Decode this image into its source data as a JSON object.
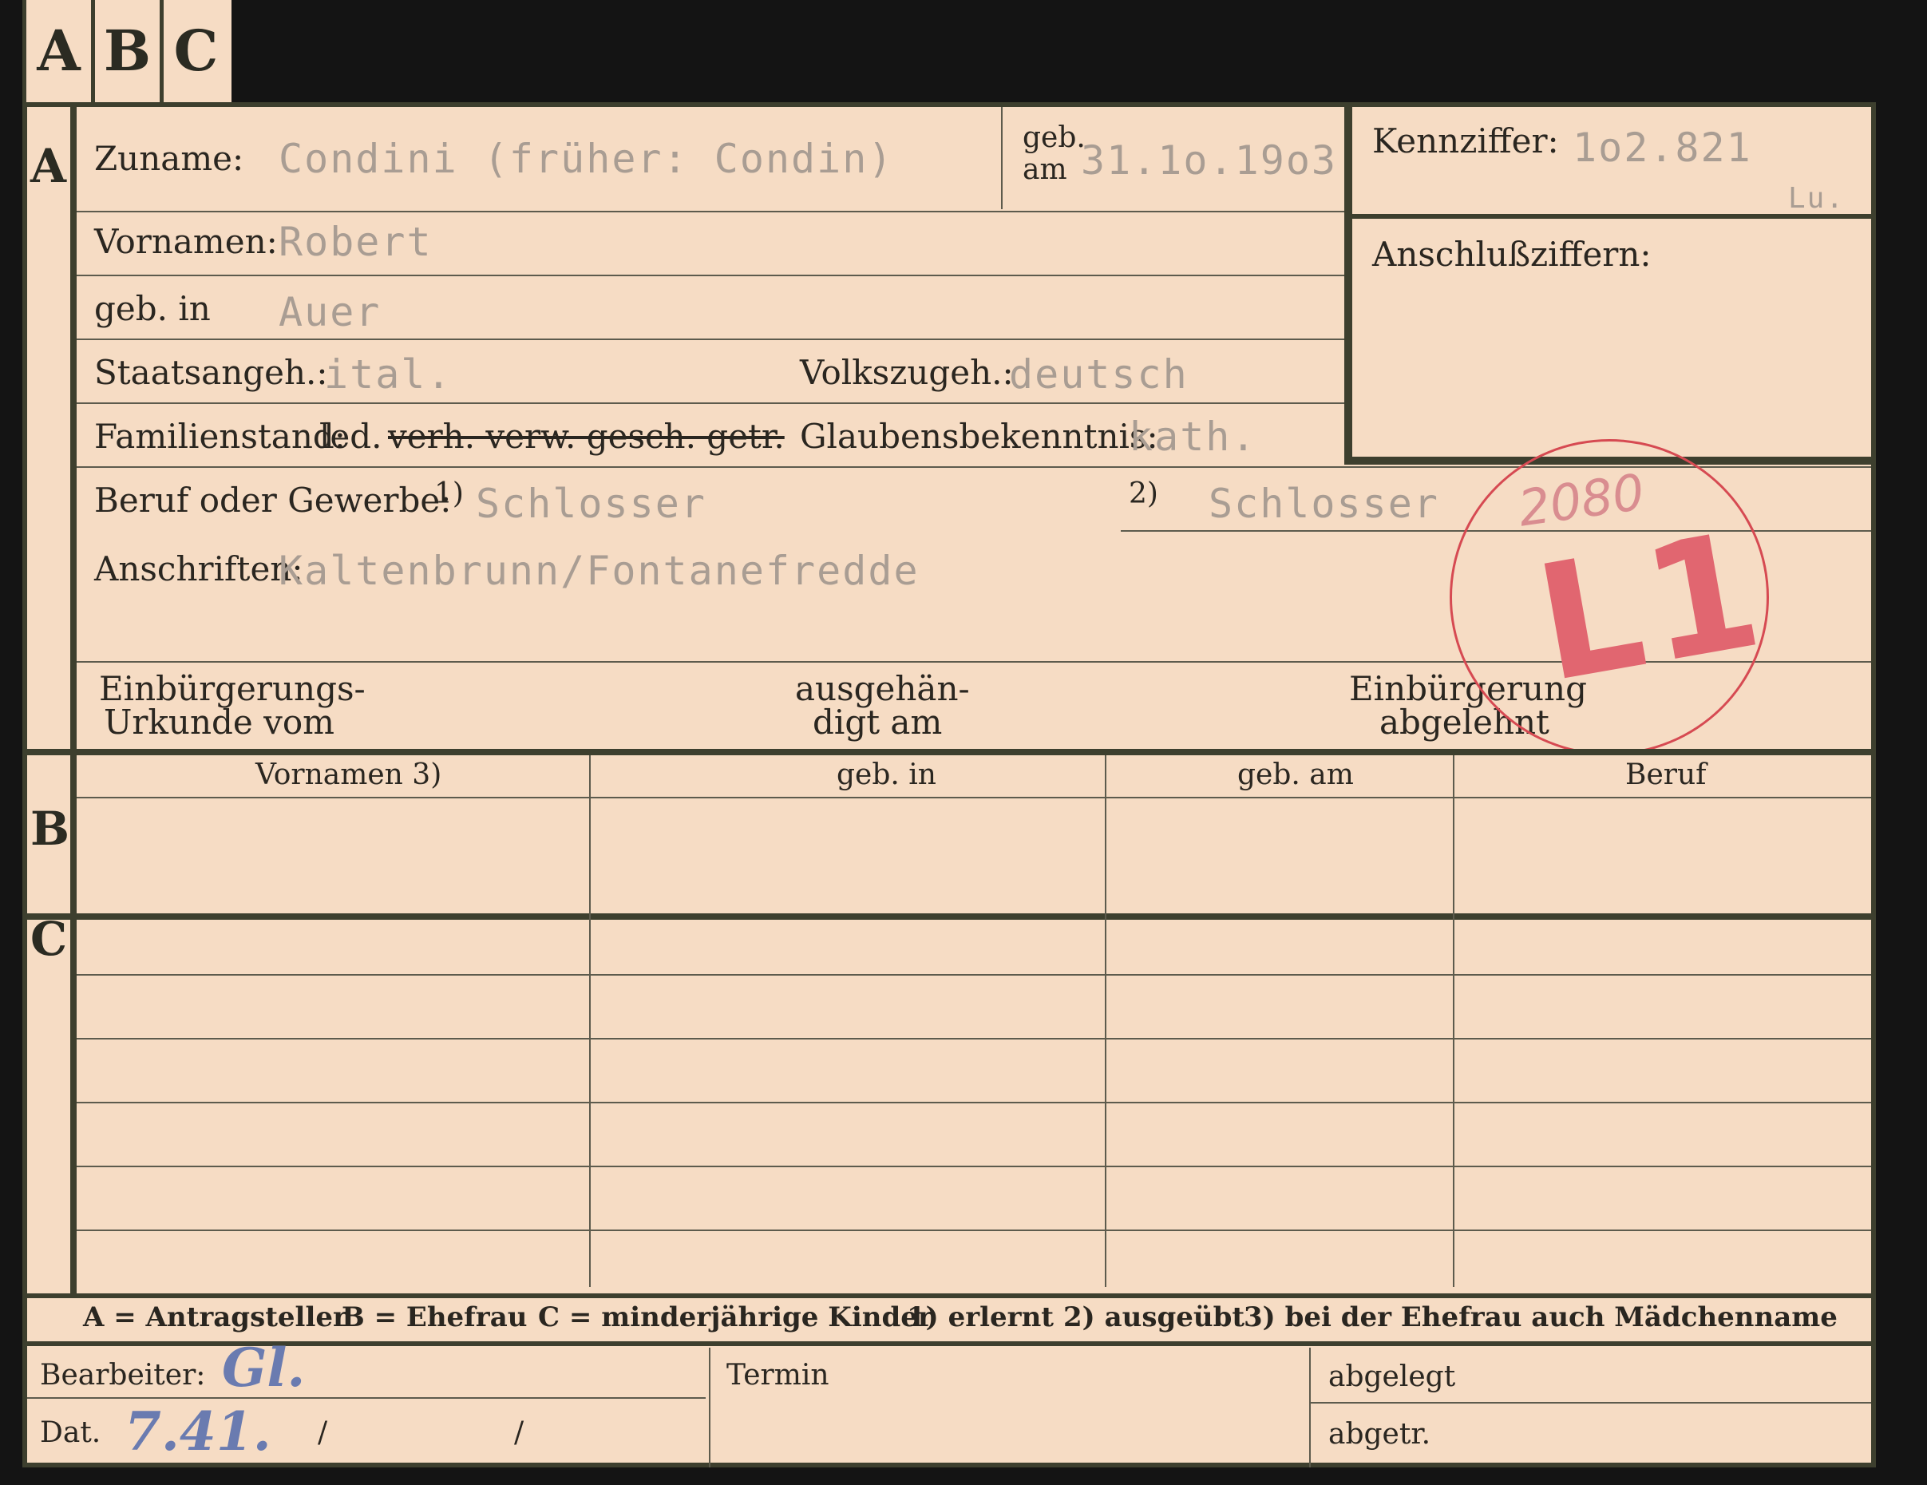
{
  "tabs": [
    "A",
    "B",
    "C"
  ],
  "section_letters": {
    "a": "A",
    "b": "B",
    "c": "C"
  },
  "fields": {
    "surname_label": "Zuname:",
    "surname_value": "Condini (früher: Condin)",
    "born_on_label_line1": "geb.",
    "born_on_label_line2": "am",
    "born_on_value": "31.1o.19o3",
    "kennziffer_label": "Kennziffer:",
    "kennziffer_value": "1o2.821",
    "kennziffer_suffix": "Lu.",
    "anschluss_label": "Anschlußziffern:",
    "first_names_label": "Vornamen:",
    "first_names_value": "Robert",
    "born_in_label": "geb. in",
    "born_in_value": "Auer",
    "citizenship_label": "Staatsangeh.:",
    "citizenship_value": "ital.",
    "ethnicity_label": "Volkszugeh.:",
    "ethnicity_value": "deutsch",
    "family_status_label": "Familienstand:",
    "family_status_selected": "led.",
    "family_status_struck": "verh. verw. gesch. getr.",
    "religion_label": "Glaubensbekenntnis:",
    "religion_value": "kath.",
    "occupation_label": "Beruf oder Gewerbe:",
    "occupation_mark_1": "1)",
    "occupation_value_1": "Schlosser",
    "occupation_mark_2": "2)",
    "occupation_value_2": "Schlosser",
    "addresses_label": "Anschriften:",
    "addresses_value": "Kaltenbrunn/Fontanefredde",
    "naturalization_cert_line1": "Einbürgerungs-",
    "naturalization_cert_line2": "Urkunde vom",
    "handed_out_line1": "ausgehän-",
    "handed_out_line2": "digt am",
    "naturalization_refused_line1": "Einbürgerung",
    "naturalization_refused_line2": "abgelehnt"
  },
  "stamp": {
    "number": "2080",
    "code": "L1",
    "color": "#d64a52"
  },
  "table": {
    "headers": [
      "Vornamen 3)",
      "geb. in",
      "geb. am",
      "Beruf"
    ]
  },
  "legend": {
    "a": "A = Antragsteller",
    "b": "B = Ehefrau",
    "c": "C = minderjährige Kinder",
    "n1": "1) erlernt",
    "n2": "2) ausgeübt",
    "n3": "3) bei der Ehefrau auch Mädchenname"
  },
  "bottom": {
    "processor_label": "Bearbeiter:",
    "processor_value": "Gl.",
    "date_label": "Dat.",
    "date_value": "7.41.",
    "date_sep_1": "/",
    "date_sep_2": "/",
    "deadline_label": "Termin",
    "filed_label": "abgelegt",
    "extracted_label": "abgetr."
  }
}
